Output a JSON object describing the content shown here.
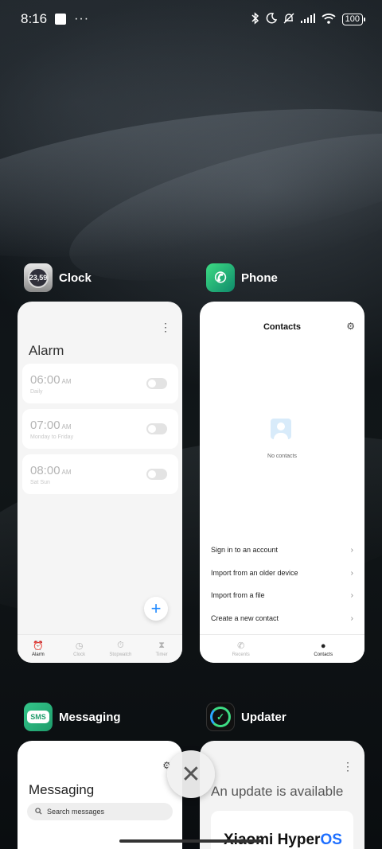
{
  "status_bar": {
    "time": "8:16",
    "more": "···",
    "bluetooth_icon": "bluetooth-icon",
    "dnd_icon": "moon-icon",
    "silent_icon": "bell-off-icon",
    "battery": "100"
  },
  "recents": [
    {
      "app_name": "Clock",
      "icon_text": "23,59",
      "title": "Alarm",
      "alarms": [
        {
          "time": "06:00",
          "ampm": "AM",
          "label": "Daily"
        },
        {
          "time": "07:00",
          "ampm": "AM",
          "label": "Monday to Friday"
        },
        {
          "time": "08:00",
          "ampm": "AM",
          "label": "Sat Sun"
        }
      ],
      "fab": "+",
      "nav": [
        "Alarm",
        "Clock",
        "Stopwatch",
        "Timer"
      ]
    },
    {
      "app_name": "Phone",
      "title": "Contacts",
      "empty_text": "No contacts",
      "actions": [
        "Sign in to an account",
        "Import from an older device",
        "Import from a file",
        "Create a new contact"
      ],
      "nav": [
        "Recents",
        "Contacts"
      ]
    },
    {
      "app_name": "Messaging",
      "icon_text": "SMS",
      "title": "Messaging",
      "search_placeholder": "Search messages"
    },
    {
      "app_name": "Updater",
      "title": "An update is available",
      "brand": "Xiaomi Hyper",
      "brand_os": "OS"
    }
  ],
  "close_label": "✕"
}
